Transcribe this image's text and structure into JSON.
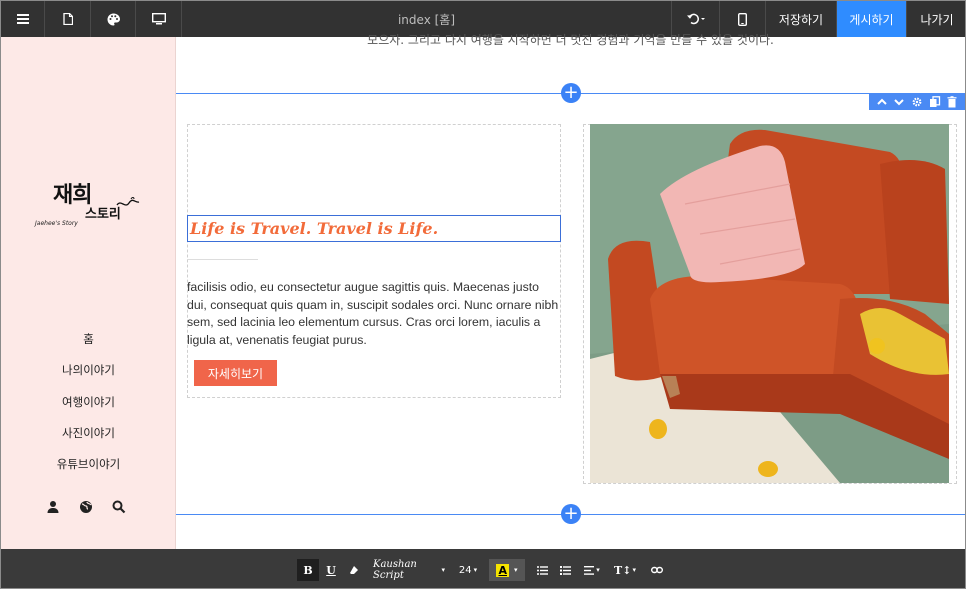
{
  "toolbar": {
    "title": "index [홈]",
    "icons": [
      "menu-icon",
      "page-icon",
      "palette-icon",
      "monitor-icon",
      "undo-icon",
      "mobile-icon"
    ],
    "save_label": "저장하기",
    "publish_label": "게시하기",
    "exit_label": "나가기",
    "publish_color": "#2f8cff"
  },
  "sidebar": {
    "background": "#fde9e7",
    "logo": {
      "title": "재희",
      "subtitle": "스토리",
      "caption": "Jaehee's Story"
    },
    "nav": [
      {
        "label": "홈"
      },
      {
        "label": "나의이야기"
      },
      {
        "label": "여행이야기"
      },
      {
        "label": "사진이야기"
      },
      {
        "label": "유튜브이야기"
      }
    ],
    "icons": [
      "user-icon",
      "globe-icon",
      "search-icon"
    ]
  },
  "canvas": {
    "top_text": "모으자. 그리고 다시 여행을 시작하면 더 멋진 경험과 기억을 만들 수 있을 것이다.",
    "accent": "#4a8af4",
    "section_tools": [
      "move-up-icon",
      "move-down-icon",
      "settings-icon",
      "copy-icon",
      "delete-icon"
    ],
    "headline": "Life is Travel. Travel is Life.",
    "headline_color": "#f26b3a",
    "body": "facilisis odio, eu consectetur augue sagittis quis. Maecenas justo dui, consequat quis quam in, suscipit sodales orci. Nunc ornare nibh sem, sed lacinia leo elementum cursus. Cras orci lorem, iaculis a ligula at, venenatis feugiat purus.",
    "cta_label": "자세히보기",
    "cta_color": "#f0654a",
    "image_subject": "orange-sofa-photo"
  },
  "format_bar": {
    "bold": "B",
    "underline": "U",
    "font": "Kaushan Script",
    "size": "24",
    "highlight_letter": "A",
    "icons": [
      "eraser-icon",
      "bullet-list-icon",
      "numbered-list-icon",
      "align-icon",
      "text-size-icon",
      "link-icon"
    ]
  }
}
